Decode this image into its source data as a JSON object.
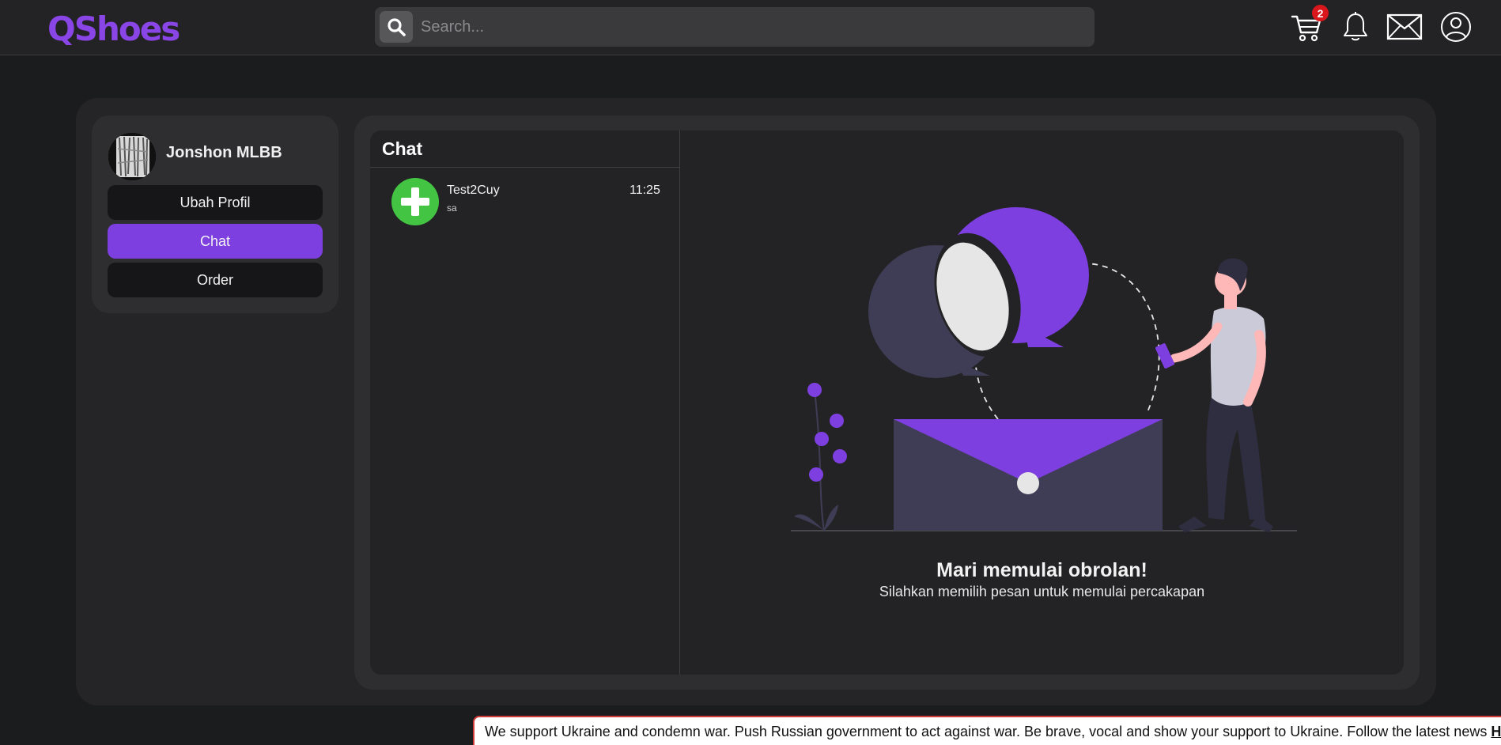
{
  "header": {
    "logo": "QShoes",
    "search": {
      "placeholder": "Search...",
      "value": ""
    },
    "cart_count": "2",
    "icons": [
      "search-icon",
      "cart-icon",
      "bell-icon",
      "mail-icon",
      "user-icon"
    ]
  },
  "sidebar": {
    "username": "Jonshon MLBB",
    "menu": [
      {
        "label": "Ubah Profil",
        "active": false
      },
      {
        "label": "Chat",
        "active": true
      },
      {
        "label": "Order",
        "active": false
      }
    ]
  },
  "chat": {
    "title": "Chat",
    "conversations": [
      {
        "name": "Test2Cuy",
        "preview": "sa",
        "time": "11:25"
      }
    ],
    "empty_title": "Mari memulai obrolan!",
    "empty_subtitle": "Silahkan memilih pesan untuk memulai percakapan"
  },
  "banner": {
    "text": "We support Ukraine and condemn war. Push Russian government to act against war. Be brave, vocal and show your support to Ukraine. Follow the latest news ",
    "link": "HERE"
  },
  "colors": {
    "accent": "#7e3fe0",
    "background": "#1b1c1e",
    "badge": "#d8161b",
    "chat_avatar": "#43c443"
  }
}
